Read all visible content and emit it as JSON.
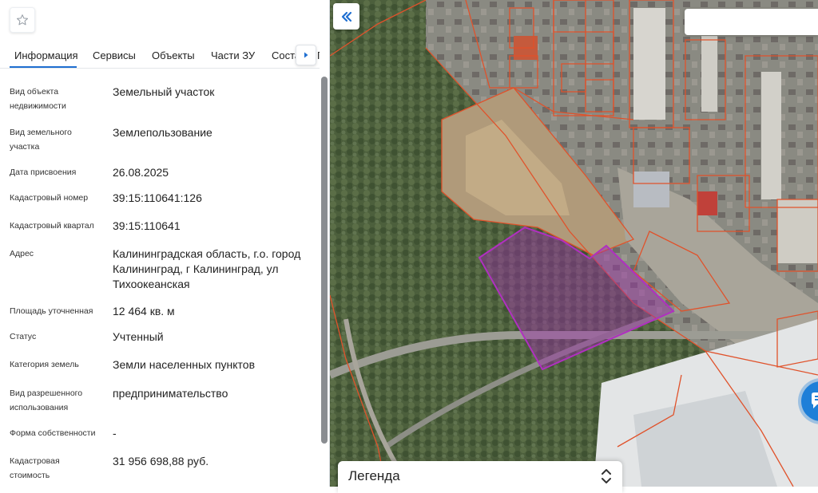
{
  "tabs": [
    "Информация",
    "Сервисы",
    "Объекты",
    "Части ЗУ",
    "Соста",
    "Г"
  ],
  "fields": [
    {
      "label": "Вид объекта недвижимости",
      "value": "Земельный участок"
    },
    {
      "label": "Вид земельного участка",
      "value": "Землепользование"
    },
    {
      "label": "Дата присвоения",
      "value": "26.08.2025"
    },
    {
      "label": "Кадастровый номер",
      "value": "39:15:110641:126"
    },
    {
      "label": "Кадастровый квартал",
      "value": "39:15:110641"
    },
    {
      "label": "Адрес",
      "value": "Калининградская область, г.о. город Калининград, г Калининград, ул Тихоокеанская"
    },
    {
      "label": "Площадь уточненная",
      "value": "12 464 кв. м"
    },
    {
      "label": "Статус",
      "value": "Учтенный"
    },
    {
      "label": "Категория земель",
      "value": "Земли населенных пунктов"
    },
    {
      "label": "Вид разрешенного использования",
      "value": "предпринимательство"
    },
    {
      "label": "Форма собственности",
      "value": "-"
    },
    {
      "label": "Кадастровая стоимость",
      "value": "31 956 698,88 руб."
    }
  ],
  "legend": {
    "title": "Легенда"
  },
  "icons": {
    "star": "star-icon",
    "next": "arrow-right-icon",
    "collapse": "double-chevron-left-icon",
    "legend_toggle": "chevron-up-down-icon",
    "chat": "chat-icon"
  },
  "colors": {
    "accent": "#1f6fd1",
    "parcel_border": "#e0522b",
    "selected_parcel": "#9b2fa8"
  }
}
